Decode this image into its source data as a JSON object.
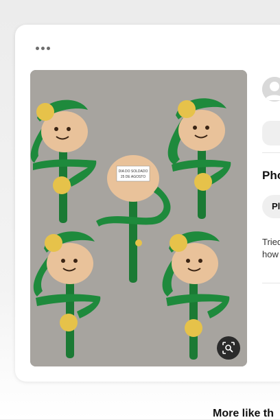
{
  "pin": {
    "more_icon": "ellipsis-icon",
    "image_sign_line1": "DIA DO SOLDADO",
    "image_sign_line2": "25 DE AGOSTO",
    "visual_search_icon": "visual-search-icon"
  },
  "details": {
    "avatar_icon": "user-avatar-icon",
    "title_partial": "Pho",
    "chip_partial": "Pl",
    "description_line1": "Tried",
    "description_line2": "how"
  },
  "footer": {
    "more_like_this": "More like th"
  },
  "colors": {
    "photo_background": "#a7a49f",
    "foam_green": "#1e8a3c",
    "face_tan": "#e9c29a",
    "yellow": "#e6c24a"
  }
}
